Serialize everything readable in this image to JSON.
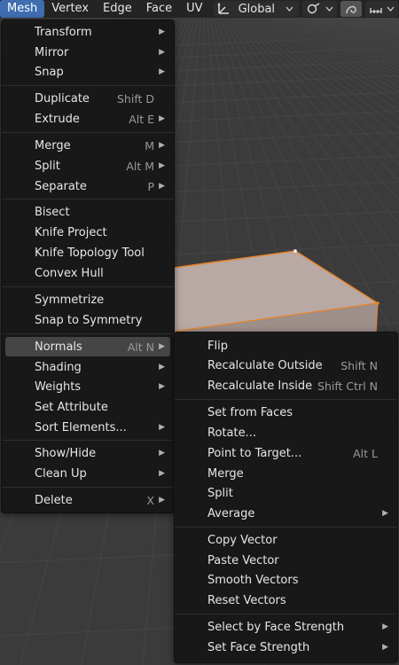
{
  "header": {
    "menus": [
      {
        "label": "Mesh",
        "active": true
      },
      {
        "label": "Vertex",
        "active": false
      },
      {
        "label": "Edge",
        "active": false
      },
      {
        "label": "Face",
        "active": false
      },
      {
        "label": "UV",
        "active": false
      }
    ],
    "orientation_label": "Global",
    "icons": [
      "transform-orientation-icon",
      "chevron-down-icon",
      "link-icon",
      "proportional-editing-icon",
      "snapping-increment-icon"
    ]
  },
  "mesh_menu": {
    "items": [
      {
        "label": "Transform",
        "shortcut": "",
        "submenu": true
      },
      {
        "label": "Mirror",
        "shortcut": "",
        "submenu": true
      },
      {
        "label": "Snap",
        "shortcut": "",
        "submenu": true
      },
      {
        "label": "Duplicate",
        "shortcut": "Shift D",
        "submenu": false
      },
      {
        "label": "Extrude",
        "shortcut": "Alt E",
        "submenu": true
      },
      {
        "label": "Merge",
        "shortcut": "M",
        "submenu": true
      },
      {
        "label": "Split",
        "shortcut": "Alt M",
        "submenu": true
      },
      {
        "label": "Separate",
        "shortcut": "P",
        "submenu": true
      },
      {
        "label": "Bisect",
        "shortcut": "",
        "submenu": false
      },
      {
        "label": "Knife Project",
        "shortcut": "",
        "submenu": false
      },
      {
        "label": "Knife Topology Tool",
        "shortcut": "",
        "submenu": false
      },
      {
        "label": "Convex Hull",
        "shortcut": "",
        "submenu": false
      },
      {
        "label": "Symmetrize",
        "shortcut": "",
        "submenu": false
      },
      {
        "label": "Snap to Symmetry",
        "shortcut": "",
        "submenu": false
      },
      {
        "label": "Normals",
        "shortcut": "Alt N",
        "submenu": true,
        "highlighted": true
      },
      {
        "label": "Shading",
        "shortcut": "",
        "submenu": true
      },
      {
        "label": "Weights",
        "shortcut": "",
        "submenu": true
      },
      {
        "label": "Set Attribute",
        "shortcut": "",
        "submenu": false
      },
      {
        "label": "Sort Elements...",
        "shortcut": "",
        "submenu": true
      },
      {
        "label": "Show/Hide",
        "shortcut": "",
        "submenu": true
      },
      {
        "label": "Clean Up",
        "shortcut": "",
        "submenu": true
      },
      {
        "label": "Delete",
        "shortcut": "X",
        "submenu": true
      }
    ]
  },
  "normals_menu": {
    "items": [
      {
        "label": "Flip",
        "shortcut": "",
        "submenu": false
      },
      {
        "label": "Recalculate Outside",
        "shortcut": "Shift N",
        "submenu": false
      },
      {
        "label": "Recalculate Inside",
        "shortcut": "Shift Ctrl N",
        "submenu": false
      },
      {
        "label": "Set from Faces",
        "shortcut": "",
        "submenu": false
      },
      {
        "label": "Rotate...",
        "shortcut": "",
        "submenu": false
      },
      {
        "label": "Point to Target...",
        "shortcut": "Alt L",
        "submenu": false
      },
      {
        "label": "Merge",
        "shortcut": "",
        "submenu": false
      },
      {
        "label": "Split",
        "shortcut": "",
        "submenu": false
      },
      {
        "label": "Average",
        "shortcut": "",
        "submenu": true
      },
      {
        "label": "Copy Vector",
        "shortcut": "",
        "submenu": false
      },
      {
        "label": "Paste Vector",
        "shortcut": "",
        "submenu": false
      },
      {
        "label": "Smooth Vectors",
        "shortcut": "",
        "submenu": false
      },
      {
        "label": "Reset Vectors",
        "shortcut": "",
        "submenu": false
      },
      {
        "label": "Select by Face Strength",
        "shortcut": "",
        "submenu": true
      },
      {
        "label": "Set Face Strength",
        "shortcut": "",
        "submenu": true
      }
    ]
  },
  "colors": {
    "accent": "#3f6db0",
    "selection_outline": "#e8842a",
    "menu_bg": "#181818",
    "highlight": "#454545"
  }
}
